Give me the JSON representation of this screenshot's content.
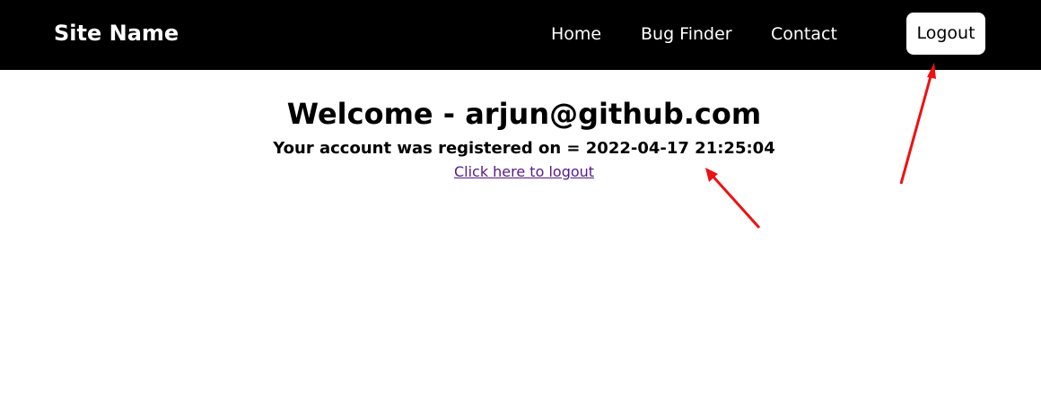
{
  "navbar": {
    "site_name": "Site Name",
    "links": [
      "Home",
      "Bug Finder",
      "Contact"
    ],
    "logout_button": "Logout"
  },
  "main": {
    "welcome_text": "Welcome - arjun@github.com",
    "registered_text": "Your account was registered on = 2022-04-17 21:25:04",
    "logout_link": "Click here to logout"
  },
  "colors": {
    "navbar_bg": "#000000",
    "annotation_arrow": "#ee1111",
    "visited_link": "#551a8b"
  }
}
